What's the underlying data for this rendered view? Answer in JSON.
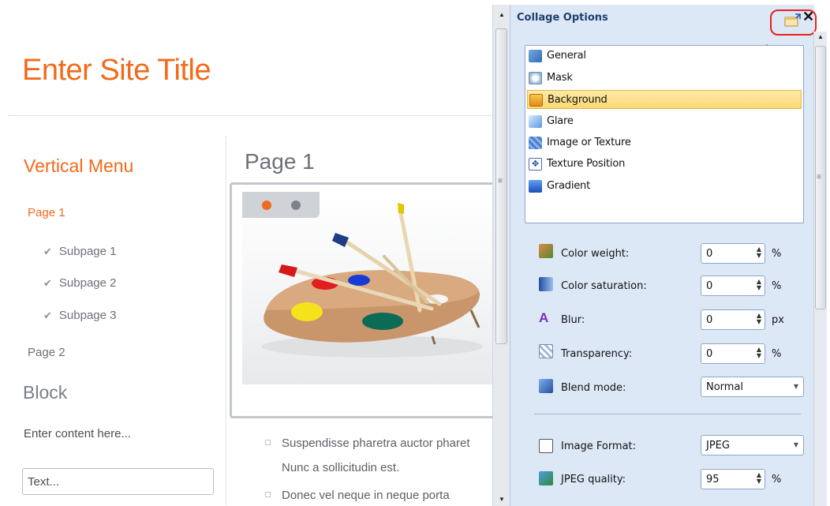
{
  "site": {
    "title": "Enter Site Title",
    "menu_heading": "Vertical Menu",
    "menu_items": [
      {
        "label": "Page 1",
        "level": 0,
        "active": true
      },
      {
        "label": "Subpage 1",
        "level": 1
      },
      {
        "label": "Subpage 2",
        "level": 1
      },
      {
        "label": "Subpage 3",
        "level": 1
      },
      {
        "label": "Page 2",
        "level": 0,
        "active": false
      }
    ],
    "block_heading": "Block",
    "block_text": "Enter content here...",
    "text_input_value": "Text...",
    "page_heading": "Page 1",
    "bullets": [
      {
        "line1": "Suspendisse pharetra auctor pharet",
        "line2": "Nunc a sollicitudin est."
      },
      {
        "line1": "Donec vel neque in neque porta"
      }
    ],
    "accent_color": "#f26a1b"
  },
  "panel": {
    "title": "Collage Options",
    "list_items": [
      {
        "label": "General",
        "icon": "general-icon"
      },
      {
        "label": "Mask",
        "icon": "mask-icon"
      },
      {
        "label": "Background",
        "icon": "background-icon",
        "selected": true
      },
      {
        "label": "Glare",
        "icon": "glare-icon"
      },
      {
        "label": "Image or Texture",
        "icon": "image-texture-icon"
      },
      {
        "label": "Texture Position",
        "icon": "texture-position-icon"
      },
      {
        "label": "Gradient",
        "icon": "gradient-icon"
      }
    ],
    "color_weight": {
      "label": "Color weight:",
      "value": "0",
      "unit": "%"
    },
    "color_saturation": {
      "label": "Color saturation:",
      "value": "0",
      "unit": "%"
    },
    "blur": {
      "label": "Blur:",
      "value": "0",
      "unit": "px"
    },
    "transparency": {
      "label": "Transparency:",
      "value": "0",
      "unit": "%"
    },
    "blend_mode": {
      "label": "Blend mode:",
      "value": "Normal"
    },
    "image_format": {
      "label": "Image Format:",
      "value": "JPEG"
    },
    "jpeg_quality": {
      "label": "JPEG quality:",
      "value": "95",
      "unit": "%"
    },
    "annotation_color": "#e8201d"
  }
}
